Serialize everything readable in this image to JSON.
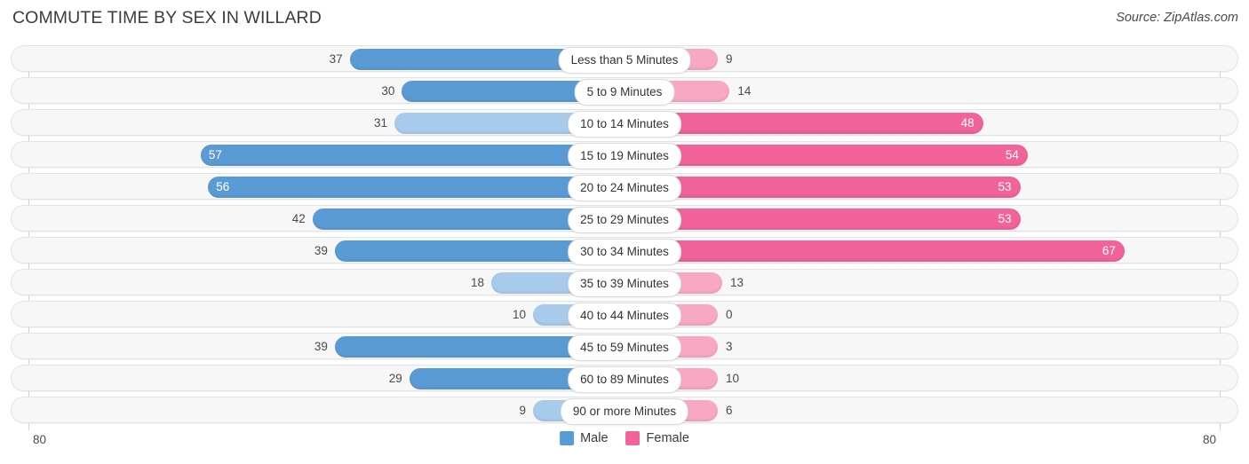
{
  "header": {
    "title": "COMMUTE TIME BY SEX IN WILLARD",
    "source": "Source: ZipAtlas.com"
  },
  "axis": {
    "left_label": "80",
    "right_label": "80"
  },
  "legend": {
    "items": [
      {
        "label": "Male",
        "color": "#5b9bd5"
      },
      {
        "label": "Female",
        "color": "#f2639a"
      }
    ]
  },
  "colors": {
    "male_strong": "#5b9bd5",
    "male_light": "#a8cbec",
    "female_strong": "#f2639a",
    "female_light": "#f9a8c4",
    "track_bg": "#f7f7f7",
    "track_border": "#e3e3e3",
    "axis_line": "#d2d2d2",
    "text": "#3b3b3b"
  },
  "chart_data": {
    "type": "bar",
    "subtype": "diverging-bidirectional",
    "title": "COMMUTE TIME BY SEX IN WILLARD",
    "xlabel": "",
    "ylabel": "",
    "xlim": [
      -80,
      80
    ],
    "axis_max": 80,
    "grid": false,
    "legend_position": "bottom-center",
    "categories": [
      "Less than 5 Minutes",
      "5 to 9 Minutes",
      "10 to 14 Minutes",
      "15 to 19 Minutes",
      "20 to 24 Minutes",
      "25 to 29 Minutes",
      "30 to 34 Minutes",
      "35 to 39 Minutes",
      "40 to 44 Minutes",
      "45 to 59 Minutes",
      "60 to 89 Minutes",
      "90 or more Minutes"
    ],
    "series": [
      {
        "name": "Male",
        "direction": "left",
        "color": "#5b9bd5",
        "values": [
          37,
          30,
          31,
          57,
          56,
          42,
          39,
          18,
          10,
          39,
          29,
          9
        ]
      },
      {
        "name": "Female",
        "direction": "right",
        "color": "#f2639a",
        "values": [
          9,
          14,
          48,
          54,
          53,
          53,
          67,
          13,
          0,
          3,
          10,
          6
        ]
      }
    ]
  },
  "rows": [
    {
      "category": "Less than 5 Minutes",
      "male": 37,
      "female": 9,
      "male_label": "37",
      "female_label": "9",
      "male_inside": false,
      "female_inside": false,
      "male_tone": "strong",
      "female_tone": "light"
    },
    {
      "category": "5 to 9 Minutes",
      "male": 30,
      "female": 14,
      "male_label": "30",
      "female_label": "14",
      "male_inside": false,
      "female_inside": false,
      "male_tone": "strong",
      "female_tone": "light"
    },
    {
      "category": "10 to 14 Minutes",
      "male": 31,
      "female": 48,
      "male_label": "31",
      "female_label": "48",
      "male_inside": false,
      "female_inside": true,
      "male_tone": "light",
      "female_tone": "strong"
    },
    {
      "category": "15 to 19 Minutes",
      "male": 57,
      "female": 54,
      "male_label": "57",
      "female_label": "54",
      "male_inside": true,
      "female_inside": true,
      "male_tone": "strong",
      "female_tone": "strong"
    },
    {
      "category": "20 to 24 Minutes",
      "male": 56,
      "female": 53,
      "male_label": "56",
      "female_label": "53",
      "male_inside": true,
      "female_inside": true,
      "male_tone": "strong",
      "female_tone": "strong"
    },
    {
      "category": "25 to 29 Minutes",
      "male": 42,
      "female": 53,
      "male_label": "42",
      "female_label": "53",
      "male_inside": false,
      "female_inside": true,
      "male_tone": "strong",
      "female_tone": "strong"
    },
    {
      "category": "30 to 34 Minutes",
      "male": 39,
      "female": 67,
      "male_label": "39",
      "female_label": "67",
      "male_inside": false,
      "female_inside": true,
      "male_tone": "strong",
      "female_tone": "strong"
    },
    {
      "category": "35 to 39 Minutes",
      "male": 18,
      "female": 13,
      "male_label": "18",
      "female_label": "13",
      "male_inside": false,
      "female_inside": false,
      "male_tone": "light",
      "female_tone": "light"
    },
    {
      "category": "40 to 44 Minutes",
      "male": 10,
      "female": 0,
      "male_label": "10",
      "female_label": "0",
      "male_inside": false,
      "female_inside": false,
      "male_tone": "light",
      "female_tone": "light"
    },
    {
      "category": "45 to 59 Minutes",
      "male": 39,
      "female": 3,
      "male_label": "39",
      "female_label": "3",
      "male_inside": false,
      "female_inside": false,
      "male_tone": "strong",
      "female_tone": "light"
    },
    {
      "category": "60 to 89 Minutes",
      "male": 29,
      "female": 10,
      "male_label": "29",
      "female_label": "10",
      "male_inside": false,
      "female_inside": false,
      "male_tone": "strong",
      "female_tone": "light"
    },
    {
      "category": "90 or more Minutes",
      "male": 9,
      "female": 6,
      "male_label": "9",
      "female_label": "6",
      "male_inside": false,
      "female_inside": false,
      "male_tone": "light",
      "female_tone": "light"
    }
  ]
}
